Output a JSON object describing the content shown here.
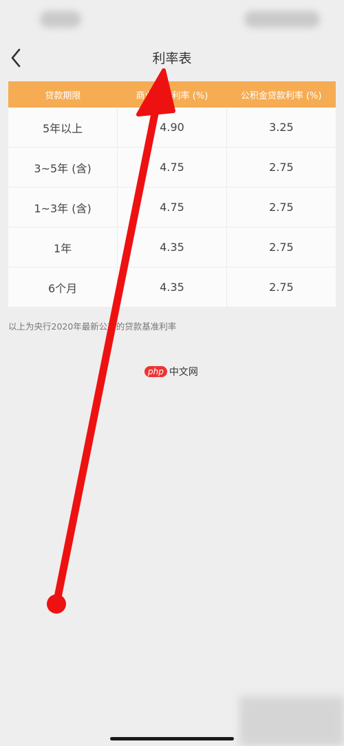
{
  "header": {
    "title": "利率表"
  },
  "table": {
    "headers": [
      "贷款期限",
      "商业贷款利率 (%)",
      "公积金贷款利率 (%)"
    ],
    "rows": [
      [
        "5年以上",
        "4.90",
        "3.25"
      ],
      [
        "3~5年 (含)",
        "4.75",
        "2.75"
      ],
      [
        "1~3年 (含)",
        "4.75",
        "2.75"
      ],
      [
        "1年",
        "4.35",
        "2.75"
      ],
      [
        "6个月",
        "4.35",
        "2.75"
      ]
    ]
  },
  "footnote": "以上为央行2020年最新公布的贷款基准利率",
  "watermark": {
    "badge": "php",
    "text": "中文网"
  },
  "colors": {
    "header_bg": "#f5ac53",
    "arrow": "#ee1111",
    "page_bg": "#efeeee"
  },
  "icons": {
    "back": "chevron-left-icon"
  }
}
